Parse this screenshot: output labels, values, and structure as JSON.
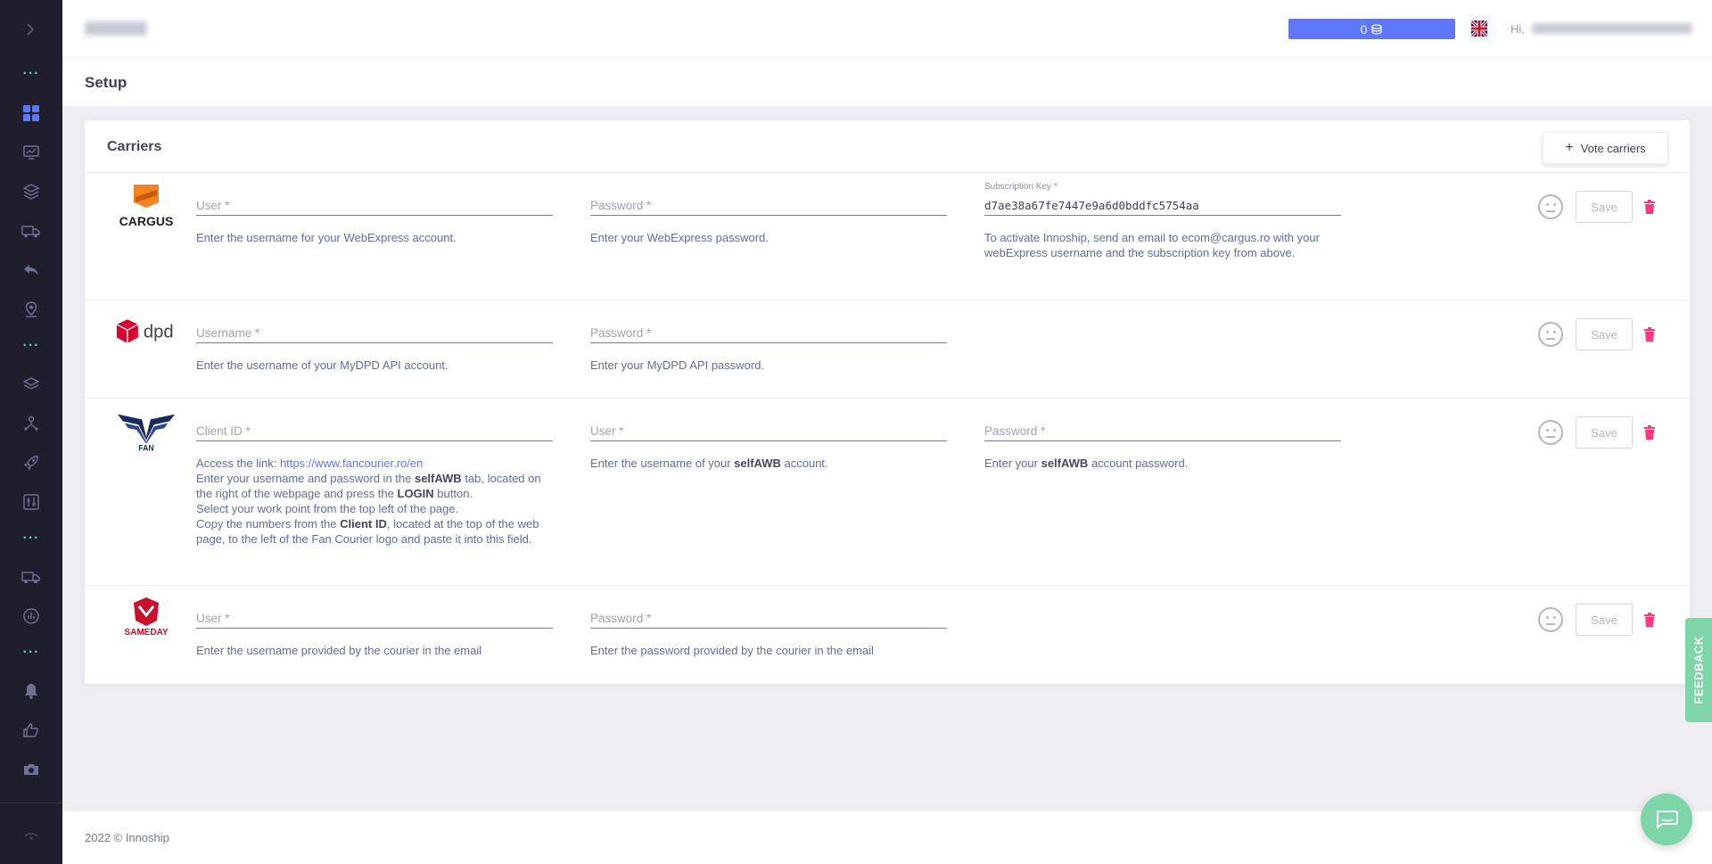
{
  "header": {
    "credits": "0",
    "greeting": "Hi,"
  },
  "subheader": {
    "title": "Setup"
  },
  "card": {
    "title": "Carriers",
    "vote_button": "Vote carriers"
  },
  "carriers": [
    {
      "name": "CARGUS",
      "fields": [
        {
          "label": "User *",
          "value": "",
          "help": "Enter the username for your WebExpress account."
        },
        {
          "label": "Password *",
          "value": "",
          "help": "Enter your WebExpress password."
        },
        {
          "label": "Subscription Key *",
          "value": "d7ae38a67fe7447e9a6d0bddfc5754aa",
          "help": "To activate Innoship, send an email to ecom@cargus.ro with your webExpress username and the subscription key from above."
        }
      ]
    },
    {
      "name": "dpd",
      "fields": [
        {
          "label": "Username *",
          "value": "",
          "help": "Enter the username of your MyDPD API account."
        },
        {
          "label": "Password *",
          "value": "",
          "help": "Enter your MyDPD API password."
        }
      ]
    },
    {
      "name": "FAN",
      "fields": [
        {
          "label": "Client ID *",
          "value": ""
        },
        {
          "label": "User *",
          "value": ""
        },
        {
          "label": "Password *",
          "value": ""
        }
      ],
      "help_client": {
        "access_prefix": "Access the link: ",
        "access_link": "https://www.fancourier.ro/en",
        "line2_a": "Enter your username and password in the ",
        "line2_b": "selfAWB",
        "line2_c": " tab, located on the right of the webpage and press the ",
        "line2_d": "LOGIN",
        "line2_e": " button.",
        "line3": "Select your work point from the top left of the page.",
        "line4_a": "Copy the numbers from the ",
        "line4_b": "Client ID",
        "line4_c": ", located at the top of the web page, to the left of the Fan Courier logo and paste it into this field."
      },
      "help_user": {
        "a": "Enter the username of your ",
        "b": "selfAWB",
        "c": " account."
      },
      "help_pass": {
        "a": "Enter your ",
        "b": "selfAWB",
        "c": " account password."
      }
    },
    {
      "name": "SAMEDAY",
      "fields": [
        {
          "label": "User *",
          "value": "",
          "help": "Enter the username provided by the courier in the email"
        },
        {
          "label": "Password *",
          "value": "",
          "help": "Enter the password provided by the courier in the email"
        }
      ]
    }
  ],
  "save_label": "Save",
  "footer": {
    "text": "2022 ©  Innoship"
  },
  "feedback": "FEEDBACK",
  "colors": {
    "accent": "#5d78ff",
    "danger": "#fd397a",
    "sidebar": "#1e1e2d",
    "feedback": "#7ed6a8"
  }
}
